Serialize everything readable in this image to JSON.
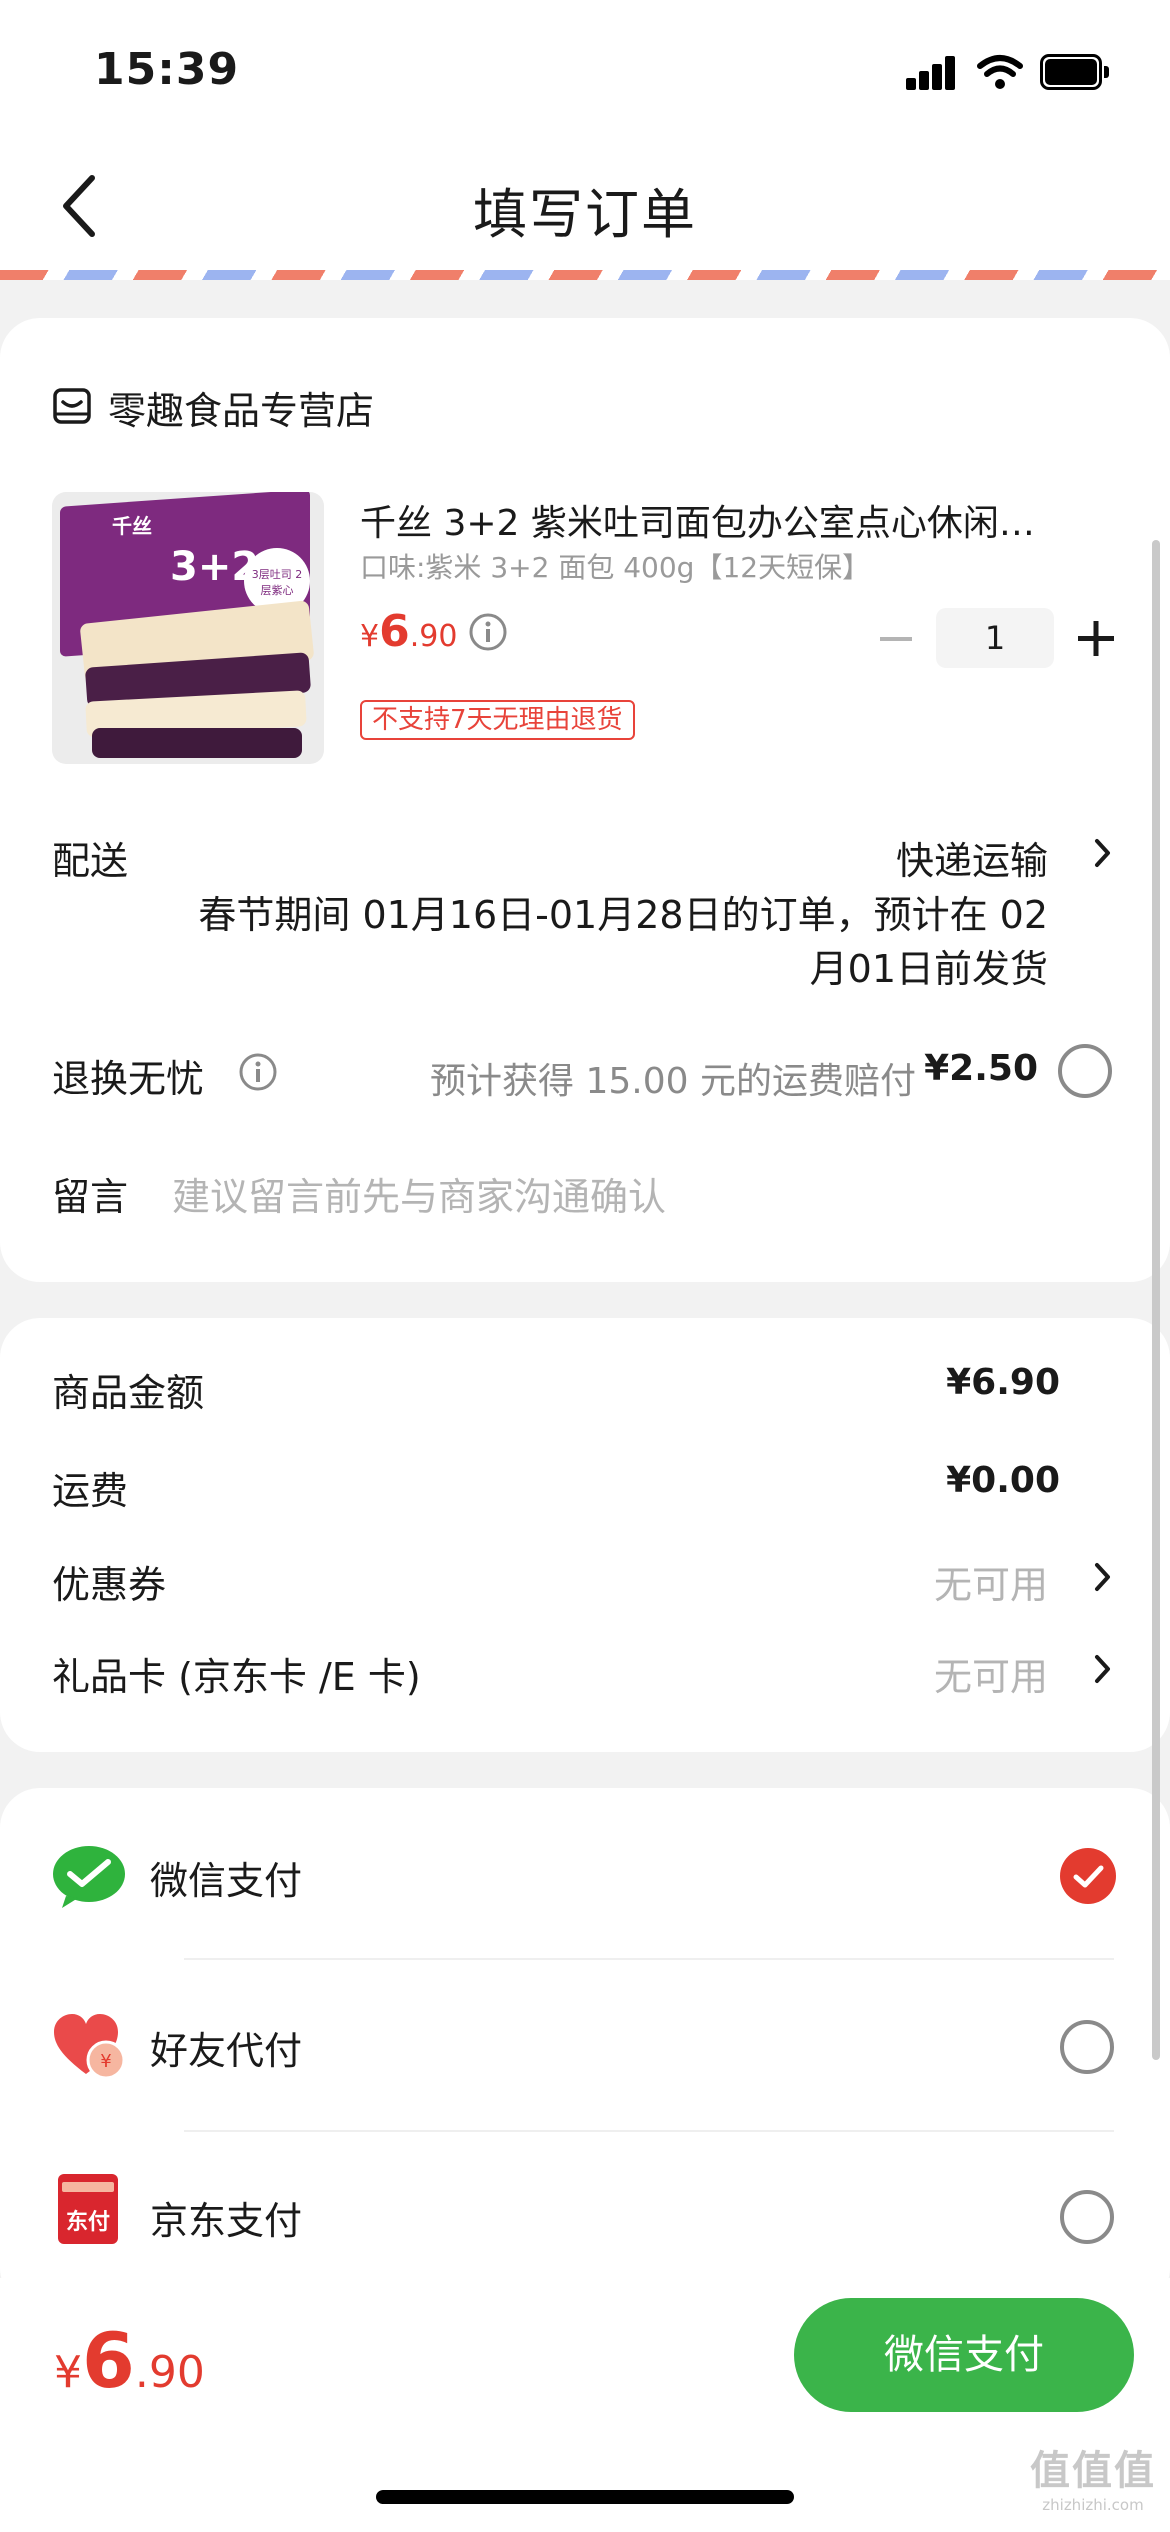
{
  "status_bar": {
    "time": "15:39"
  },
  "header": {
    "title": "填写订单"
  },
  "shop": {
    "name": "零趣食品专营店"
  },
  "product": {
    "title": "千丝 3+2 紫米吐司面包办公室点心休闲…",
    "spec": "口味:紫米 3+2 面包 400g【12天短保】",
    "price_symbol": "¥",
    "price_int": "6",
    "price_dec": ".90",
    "quantity": "1",
    "return_tag": "不支持7天无理由退货",
    "thumb_text_big": "3+2",
    "thumb_text_small": "3层吐司 2层紫心",
    "thumb_brand": "千丝"
  },
  "delivery": {
    "label": "配送",
    "method": "快递运输",
    "note_line1": "春节期间 01月16日-01月28日的订单，预计在 02",
    "note_line2": "月01日前发货"
  },
  "return_insurance": {
    "label": "退换无忧",
    "desc": "预计获得 15.00 元的运费赔付",
    "price": "¥2.50"
  },
  "message": {
    "label": "留言",
    "placeholder": "建议留言前先与商家沟通确认"
  },
  "summary": {
    "goods_label": "商品金额",
    "goods_value": "¥6.90",
    "shipping_label": "运费",
    "shipping_value": "¥0.00",
    "coupon_label": "优惠券",
    "coupon_value": "无可用",
    "giftcard_label": "礼品卡 (京东卡 /E 卡)",
    "giftcard_value": "无可用"
  },
  "payment": {
    "options": [
      {
        "label": "微信支付",
        "selected": true,
        "icon": "wechat-pay-icon"
      },
      {
        "label": "好友代付",
        "selected": false,
        "icon": "friend-pay-icon"
      },
      {
        "label": "京东支付",
        "selected": false,
        "icon": "jd-pay-icon",
        "icon_text": "东付"
      }
    ]
  },
  "bottom": {
    "total_symbol": "¥",
    "total_int": "6",
    "total_dec": ".90",
    "pay_button": "微信支付"
  },
  "watermark": {
    "line1": "值值值",
    "line2": "zhizhizhi.com"
  },
  "colors": {
    "accent_red": "#e33b2f",
    "wechat_green": "#3bb44a"
  }
}
